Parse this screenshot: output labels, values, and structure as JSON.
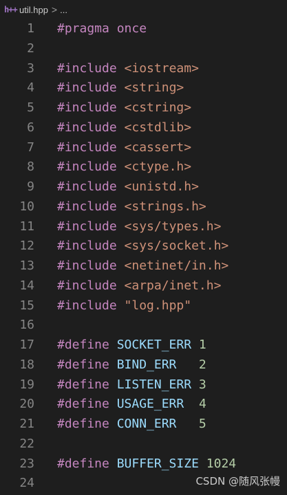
{
  "breadcrumb": {
    "icon": "h++",
    "file": "util.hpp",
    "separator": ">",
    "more": "..."
  },
  "colors": {
    "background": "#1e1e1e",
    "line_number": "#858585",
    "directive": "#c586c0",
    "include_path": "#ce9178",
    "macro_name": "#9cdcfe",
    "number": "#b5cea8"
  },
  "lines": [
    {
      "n": "1",
      "tokens": [
        {
          "t": "#pragma once",
          "c": "kw"
        }
      ]
    },
    {
      "n": "2",
      "tokens": []
    },
    {
      "n": "3",
      "tokens": [
        {
          "t": "#include ",
          "c": "kw"
        },
        {
          "t": "<iostream>",
          "c": "inc"
        }
      ]
    },
    {
      "n": "4",
      "tokens": [
        {
          "t": "#include ",
          "c": "kw"
        },
        {
          "t": "<string>",
          "c": "inc"
        }
      ]
    },
    {
      "n": "5",
      "tokens": [
        {
          "t": "#include ",
          "c": "kw"
        },
        {
          "t": "<cstring>",
          "c": "inc"
        }
      ]
    },
    {
      "n": "6",
      "tokens": [
        {
          "t": "#include ",
          "c": "kw"
        },
        {
          "t": "<cstdlib>",
          "c": "inc"
        }
      ]
    },
    {
      "n": "7",
      "tokens": [
        {
          "t": "#include ",
          "c": "kw"
        },
        {
          "t": "<cassert>",
          "c": "inc"
        }
      ]
    },
    {
      "n": "8",
      "tokens": [
        {
          "t": "#include ",
          "c": "kw"
        },
        {
          "t": "<ctype.h>",
          "c": "inc"
        }
      ]
    },
    {
      "n": "9",
      "tokens": [
        {
          "t": "#include ",
          "c": "kw"
        },
        {
          "t": "<unistd.h>",
          "c": "inc"
        }
      ]
    },
    {
      "n": "10",
      "tokens": [
        {
          "t": "#include ",
          "c": "kw"
        },
        {
          "t": "<strings.h>",
          "c": "inc"
        }
      ]
    },
    {
      "n": "11",
      "tokens": [
        {
          "t": "#include ",
          "c": "kw"
        },
        {
          "t": "<sys/types.h>",
          "c": "inc"
        }
      ]
    },
    {
      "n": "12",
      "tokens": [
        {
          "t": "#include ",
          "c": "kw"
        },
        {
          "t": "<sys/socket.h>",
          "c": "inc"
        }
      ]
    },
    {
      "n": "13",
      "tokens": [
        {
          "t": "#include ",
          "c": "kw"
        },
        {
          "t": "<netinet/in.h>",
          "c": "inc"
        }
      ]
    },
    {
      "n": "14",
      "tokens": [
        {
          "t": "#include ",
          "c": "kw"
        },
        {
          "t": "<arpa/inet.h>",
          "c": "inc"
        }
      ]
    },
    {
      "n": "15",
      "tokens": [
        {
          "t": "#include ",
          "c": "kw"
        },
        {
          "t": "\"log.hpp\"",
          "c": "inc"
        }
      ]
    },
    {
      "n": "16",
      "tokens": []
    },
    {
      "n": "17",
      "tokens": [
        {
          "t": "#define ",
          "c": "kw"
        },
        {
          "t": "SOCKET_ERR",
          "c": "ident"
        },
        {
          "t": " ",
          "c": "plain"
        },
        {
          "t": "1",
          "c": "num"
        }
      ]
    },
    {
      "n": "18",
      "tokens": [
        {
          "t": "#define ",
          "c": "kw"
        },
        {
          "t": "BIND_ERR",
          "c": "ident"
        },
        {
          "t": "   ",
          "c": "plain"
        },
        {
          "t": "2",
          "c": "num"
        }
      ]
    },
    {
      "n": "19",
      "tokens": [
        {
          "t": "#define ",
          "c": "kw"
        },
        {
          "t": "LISTEN_ERR",
          "c": "ident"
        },
        {
          "t": " ",
          "c": "plain"
        },
        {
          "t": "3",
          "c": "num"
        }
      ]
    },
    {
      "n": "20",
      "tokens": [
        {
          "t": "#define ",
          "c": "kw"
        },
        {
          "t": "USAGE_ERR",
          "c": "ident"
        },
        {
          "t": "  ",
          "c": "plain"
        },
        {
          "t": "4",
          "c": "num"
        }
      ]
    },
    {
      "n": "21",
      "tokens": [
        {
          "t": "#define ",
          "c": "kw"
        },
        {
          "t": "CONN_ERR",
          "c": "ident"
        },
        {
          "t": "   ",
          "c": "plain"
        },
        {
          "t": "5",
          "c": "num"
        }
      ]
    },
    {
      "n": "22",
      "tokens": []
    },
    {
      "n": "23",
      "tokens": [
        {
          "t": "#define ",
          "c": "kw"
        },
        {
          "t": "BUFFER_SIZE",
          "c": "ident"
        },
        {
          "t": " ",
          "c": "plain"
        },
        {
          "t": "1024",
          "c": "num"
        }
      ]
    },
    {
      "n": "24",
      "tokens": []
    }
  ],
  "watermark": "CSDN @随风张幔"
}
